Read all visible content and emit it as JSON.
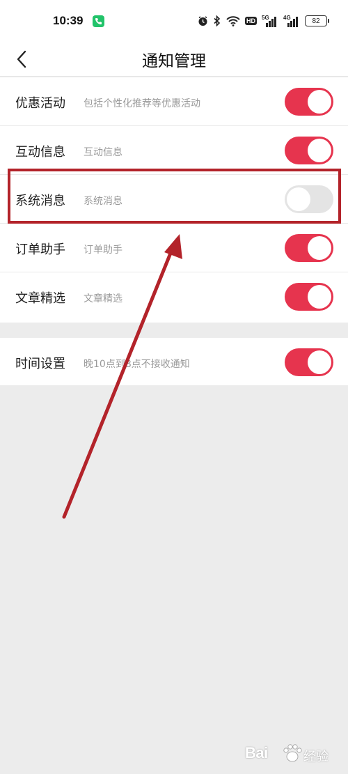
{
  "status_bar": {
    "time": "10:39",
    "battery": "82",
    "hd_label": "HD",
    "network_1": "5G",
    "network_2": "4G"
  },
  "nav": {
    "title": "通知管理"
  },
  "settings": [
    {
      "title": "优惠活动",
      "desc": "包括个性化推荐等优惠活动",
      "enabled": true
    },
    {
      "title": "互动信息",
      "desc": "互动信息",
      "enabled": true
    },
    {
      "title": "系统消息",
      "desc": "系统消息",
      "enabled": false
    },
    {
      "title": "订单助手",
      "desc": "订单助手",
      "enabled": true
    },
    {
      "title": "文章精选",
      "desc": "文章精选",
      "enabled": true
    }
  ],
  "time_setting": {
    "title": "时间设置",
    "desc": "晚10点到8点不接收通知",
    "enabled": true
  },
  "watermark": {
    "brand": "Bai",
    "suffix": "经验"
  },
  "colors": {
    "toggle_on": "#e6344e",
    "toggle_off": "#e4e4e4",
    "annotation": "#b3232a"
  }
}
